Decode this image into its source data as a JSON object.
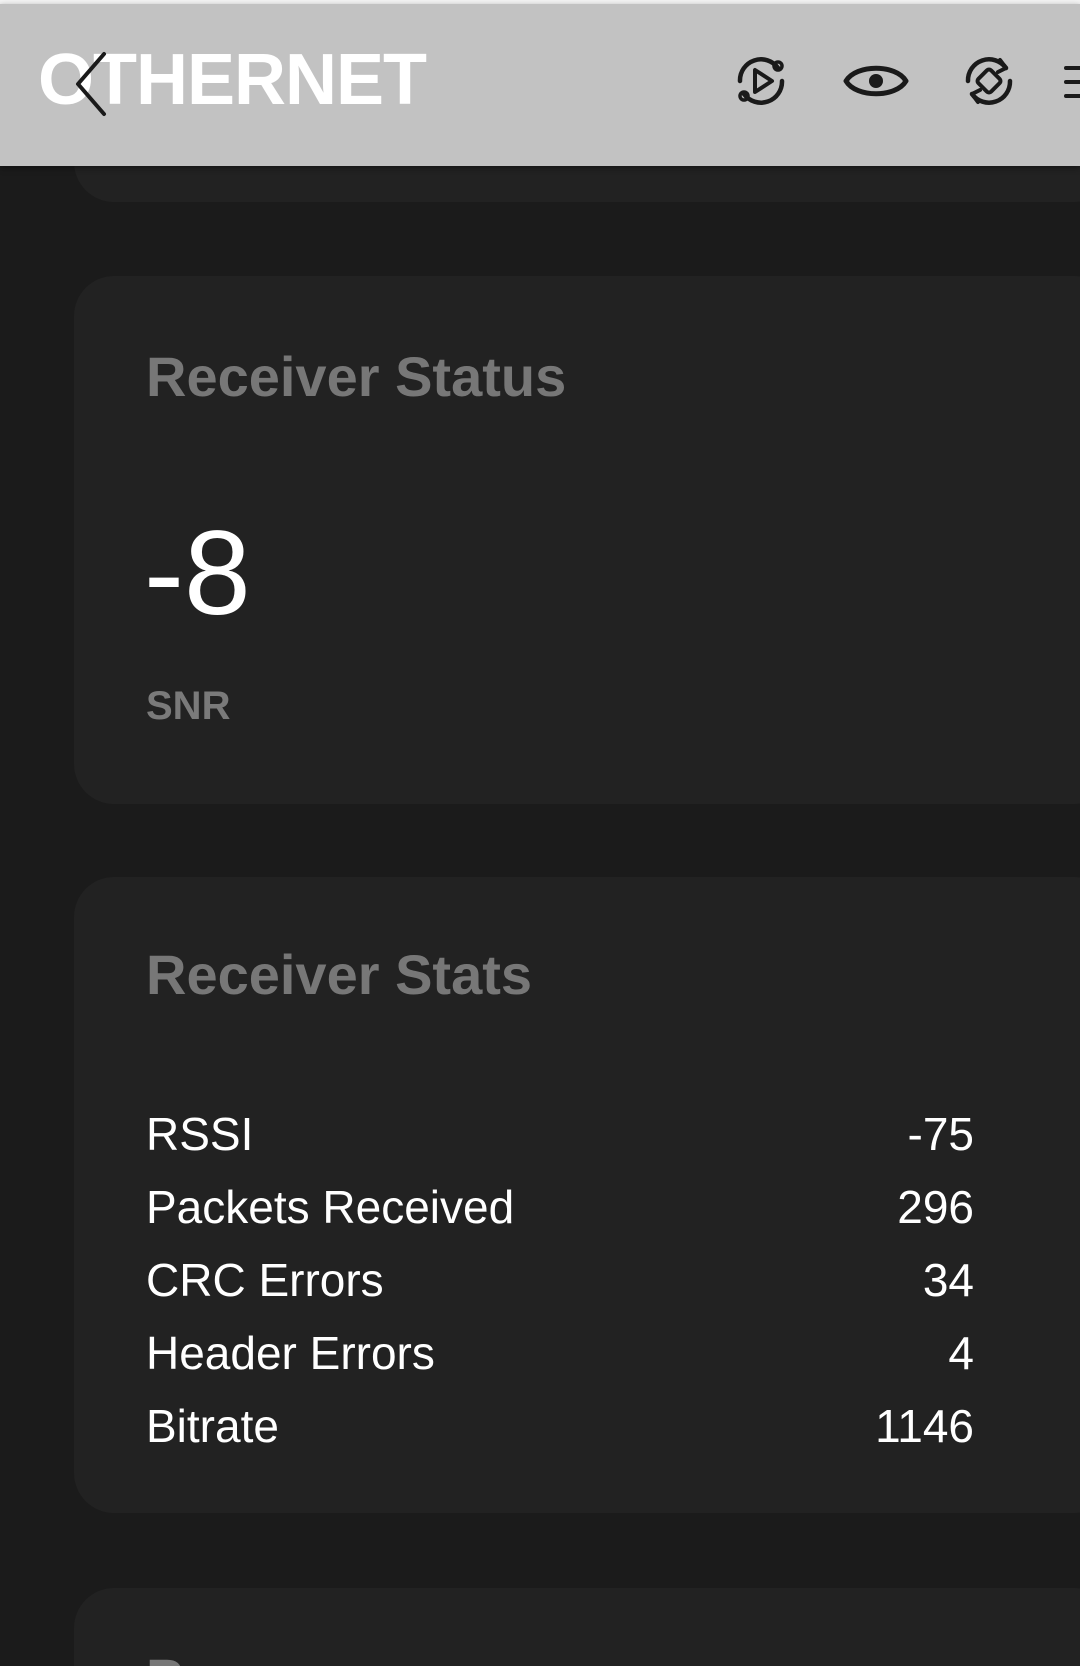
{
  "header": {
    "brand": "OTHERNET",
    "icons": [
      "back-chevron-icon",
      "play-sync-icon",
      "eye-icon",
      "sync-diamond-icon",
      "menu-icon"
    ]
  },
  "receiver_status": {
    "title": "Receiver Status",
    "value": "-8",
    "label": "SNR"
  },
  "receiver_stats": {
    "title": "Receiver Stats",
    "rows": [
      {
        "label": "RSSI",
        "value": "-75"
      },
      {
        "label": "Packets Received",
        "value": "296"
      },
      {
        "label": "CRC Errors",
        "value": "34"
      },
      {
        "label": "Header Errors",
        "value": "4"
      },
      {
        "label": "Bitrate",
        "value": "1146"
      }
    ]
  },
  "next_card": {
    "title_partial": "Pa..."
  },
  "colors": {
    "header_bg": "#c2c2c2",
    "page_bg": "#1b1b1b",
    "card_bg": "#222222",
    "title_gray": "#777777",
    "value_white": "#ffffff"
  }
}
